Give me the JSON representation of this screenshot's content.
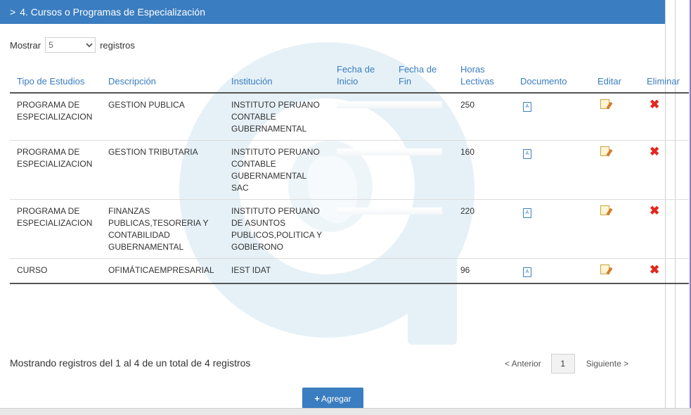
{
  "section": {
    "title": "4. Cursos o Programas de Especialización"
  },
  "length_control": {
    "label_before": "Mostrar",
    "value": "5",
    "label_after": "registros"
  },
  "table": {
    "headers": {
      "tipo": "Tipo de Estudios",
      "descripcion": "Descripción",
      "institucion": "Institución",
      "fecha_inicio": "Fecha de Inicio",
      "fecha_fin": "Fecha de Fin",
      "horas": "Horas Lectivas",
      "documento": "Documento",
      "editar": "Editar",
      "eliminar": "Eliminar"
    },
    "rows": [
      {
        "tipo": "PROGRAMA DE ESPECIALIZACION",
        "descripcion": "GESTION PUBLICA",
        "institucion": "INSTITUTO PERUANO CONTABLE GUBERNAMENTAL",
        "horas": "250"
      },
      {
        "tipo": "PROGRAMA DE ESPECIALIZACION",
        "descripcion": "GESTION TRIBUTARIA",
        "institucion": "INSTITUTO PERUANO CONTABLE GUBERNAMENTAL SAC",
        "horas": "160"
      },
      {
        "tipo": "PROGRAMA DE ESPECIALIZACION",
        "descripcion": "FINANZAS PUBLICAS,TESORERIA Y CONTABILIDAD GUBERNAMENTAL",
        "institucion": "INSTITUTO PERUANO DE ASUNTOS PUBLICOS,POLITICA Y GOBIERONO",
        "horas": "220"
      },
      {
        "tipo": "CURSO",
        "descripcion": "OFIMÁTICAEMPRESARIAL",
        "institucion": "IEST IDAT",
        "horas": "96"
      }
    ]
  },
  "info_text": "Mostrando registros del 1 al 4 de un total de 4 registros",
  "pagination": {
    "prev": "< Anterior",
    "current": "1",
    "next": "Siguiente >"
  },
  "add_button": {
    "label": "Agregar"
  },
  "colors": {
    "header_bg": "#3a7dc0",
    "link": "#3a7dc0",
    "delete": "#e0281f"
  },
  "icons": {
    "document": "pdf-document-icon",
    "edit": "edit-icon",
    "delete": "delete-icon"
  }
}
